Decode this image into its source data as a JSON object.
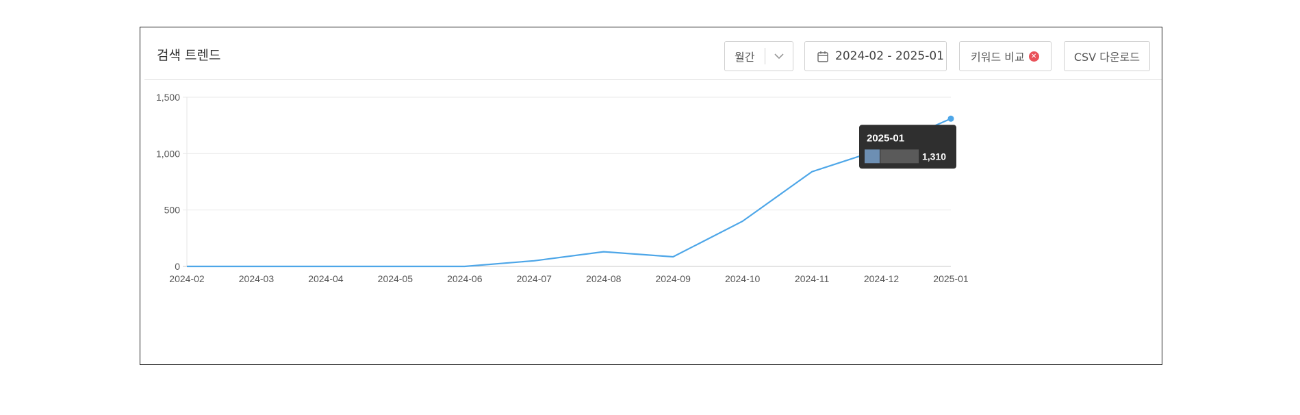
{
  "header": {
    "title": "검색 트렌드",
    "period_label": "월간",
    "date_range": "2024-02 - 2025-01",
    "compare_label": "키워드 비교",
    "csv_label": "CSV 다운로드"
  },
  "icons": {
    "period_dropdown": "chevron-down-icon",
    "date": "calendar-icon",
    "compare_badge": "close-badge-icon"
  },
  "colors": {
    "line": "#4da6e8",
    "tooltip_bg": "#2f2f2f",
    "compare_badge": "#e9525a"
  },
  "tooltip": {
    "title": "2025-01",
    "value": "1,310"
  },
  "chart_data": {
    "type": "line",
    "categories": [
      "2024-02",
      "2024-03",
      "2024-04",
      "2024-05",
      "2024-06",
      "2024-07",
      "2024-08",
      "2024-09",
      "2024-10",
      "2024-11",
      "2024-12",
      "2025-01"
    ],
    "series": [
      {
        "values": [
          0,
          0,
          0,
          0,
          0,
          50,
          130,
          85,
          400,
          840,
          1040,
          1310
        ]
      }
    ],
    "ylim": [
      0,
      1500
    ],
    "yticks": [
      0,
      500,
      1000,
      1500
    ],
    "ytick_labels": [
      "0",
      "500",
      "1,000",
      "1,500"
    ],
    "grid": true,
    "legend": "none"
  }
}
